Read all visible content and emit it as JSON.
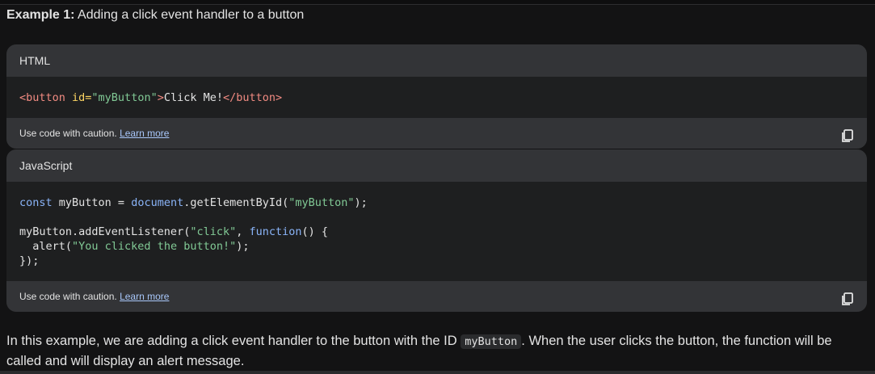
{
  "heading": {
    "bold": "Example 1:",
    "text": " Adding a click event handler to a button"
  },
  "code_blocks": [
    {
      "language": "HTML",
      "lines": [
        [
          {
            "t": "<button ",
            "c": "tag"
          },
          {
            "t": "id=",
            "c": "attr"
          },
          {
            "t": "\"myButton\"",
            "c": "str"
          },
          {
            "t": ">",
            "c": "tag"
          },
          {
            "t": "Click Me!",
            "c": "plain"
          },
          {
            "t": "</button>",
            "c": "tag"
          }
        ]
      ],
      "footer_text": "Use code with caution. ",
      "footer_link": "Learn more"
    },
    {
      "language": "JavaScript",
      "lines": [
        [
          {
            "t": "const",
            "c": "kw"
          },
          {
            "t": " myButton = ",
            "c": "plain"
          },
          {
            "t": "document",
            "c": "obj"
          },
          {
            "t": ".getElementById(",
            "c": "plain"
          },
          {
            "t": "\"myButton\"",
            "c": "str"
          },
          {
            "t": ");",
            "c": "plain"
          }
        ],
        [],
        [
          {
            "t": "myButton.addEventListener(",
            "c": "plain"
          },
          {
            "t": "\"click\"",
            "c": "str"
          },
          {
            "t": ", ",
            "c": "plain"
          },
          {
            "t": "function",
            "c": "kw"
          },
          {
            "t": "() {",
            "c": "plain"
          }
        ],
        [
          {
            "t": "  alert(",
            "c": "plain"
          },
          {
            "t": "\"You clicked the button!\"",
            "c": "str"
          },
          {
            "t": ");",
            "c": "plain"
          }
        ],
        [
          {
            "t": "});",
            "c": "plain"
          }
        ]
      ],
      "footer_text": "Use code with caution. ",
      "footer_link": "Learn more"
    }
  ],
  "paragraph": {
    "before": "In this example, we are adding a click event handler to the button with the ID ",
    "code": "myButton",
    "after": ". When the user clicks the button, the function will be called and will display an alert message."
  },
  "icons": {
    "copy": "copy-icon"
  }
}
